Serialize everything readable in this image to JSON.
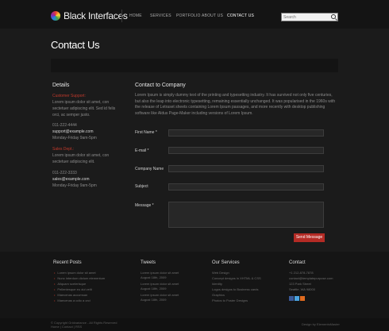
{
  "header": {
    "logo_text": "Black Interfaces",
    "nav": [
      "HOME",
      "SERVICES",
      "PORTFOLIO",
      "ABOUT US",
      "CONTACT US"
    ],
    "active_nav": "CONTACT US",
    "search_placeholder": "Search"
  },
  "page_title": "Contact Us",
  "details": {
    "title": "Details",
    "support_label": "Customer Support:",
    "support_text": "Lorem ipsum dolor sit amet, con sectetuer adipiscing elit. Sed id felis orci, ac semper justo.",
    "support_phone": "011-222-4444",
    "support_email": "support@example.com",
    "support_hours": "Monday-Friday 9am-5pm",
    "sales_label": "Sales Dept.:",
    "sales_text": "Lorem ipsum dolor sit amet, con sectetuer adipiscing elit.",
    "sales_phone": "011-222-3333",
    "sales_email": "sales@example.com",
    "sales_hours": "Monday-Friday 9am-5pm"
  },
  "contact": {
    "title": "Contact to Company",
    "intro": "Lorem Ipsum is simply dummy text of the printing and typesetting industry. It has survived not only five centuries, but also the leap into electronic typesetting, remaining essentially unchanged. It was popularised in the 1960s with the release of Letraset sheets containing Lorem Ipsum passages, and more recently with desktop publishing software like Aldus Page-Maker including versions of Lorem Ipsum.",
    "fields": [
      "First Name *",
      "E-mail *",
      "Company Name",
      "Subject",
      "Message *"
    ],
    "send_label": "Send Message"
  },
  "footer": {
    "recent_posts_title": "Recent Posts",
    "recent_posts": [
      "Lorem ipsum dolor sit amet",
      "Nunc interdum dictum elementum",
      "Aliquam scelerisque",
      "Pellentesque eu dui velit",
      "Maecenas accumsan",
      "Maecenas a odio a orci"
    ],
    "tweets_title": "Tweets",
    "tweets": [
      {
        "text": "Lorem ipsum dolor sit amet",
        "date": "August 18th, 2009"
      },
      {
        "text": "Lorem ipsum dolor sit amet",
        "date": "August 18th, 2009"
      },
      {
        "text": "Lorem ipsum dolor sit amet",
        "date": "August 18th, 2009"
      }
    ],
    "services_title": "Our Services",
    "services": [
      "Web Design",
      "Concept designs in XHTML & CSS",
      "Identity",
      "Logos designs to Business cards",
      "Graphics",
      "Photos to Poster Designs"
    ],
    "contact_title": "Contact",
    "contact_lines": [
      "+1 212-878-7878",
      "contact@templatepurpose.com",
      "123 Park Street",
      "Seattle, WA 98000"
    ],
    "social_colors": [
      "#3b5998",
      "#4aa3df",
      "#e06b20"
    ]
  },
  "bottom": {
    "copyright_line1": "© Copyright Gridvariance - All Rights Reserved",
    "copyright_line2": "Home | Contact | RSS",
    "credit": "Design by ElementsMaster"
  },
  "colors": {
    "accent": "#b42b25",
    "background": "#1b1b1b",
    "header": "#141414"
  }
}
